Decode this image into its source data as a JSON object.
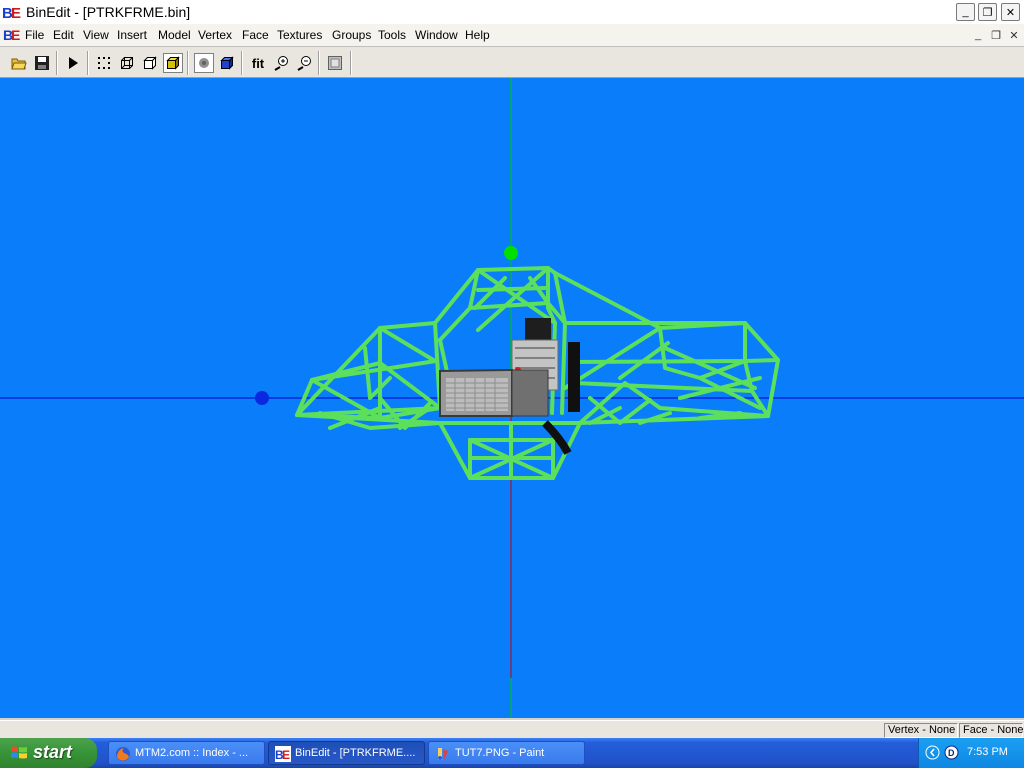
{
  "window": {
    "title": "BinEdit - [PTRKFRME.bin]",
    "minimize_label": "_",
    "maximize_label": "❐",
    "close_label": "✕"
  },
  "menu": {
    "items": [
      "File",
      "Edit",
      "View",
      "Insert",
      "Model",
      "Vertex",
      "Face",
      "Textures",
      "Groups",
      "Tools",
      "Window",
      "Help"
    ],
    "mdi_minimize": "_",
    "mdi_restore": "❐",
    "mdi_close": "✕"
  },
  "toolbar": {
    "fit_label": "fit",
    "icons": [
      "open-folder-icon",
      "save-icon",
      "play-icon",
      "vertices-icon",
      "wireframe-icon",
      "box-outline-icon",
      "solid-box-icon",
      "point-icon",
      "cube-icon",
      "zoom-in-icon",
      "zoom-out-icon",
      "grid-icon"
    ]
  },
  "viewport": {
    "background": "#0a7dfb",
    "wire_color": "#5ce05c",
    "axis_x_color": "#0000c8",
    "axis_y_color": "#00c800",
    "axis_z_color": "#c80000"
  },
  "status": {
    "vertex": "Vertex - None",
    "face": "Face - None"
  },
  "taskbar": {
    "start_label": "start",
    "tasks": [
      {
        "label": "MTM2.com :: Index - ...",
        "icon": "firefox-icon"
      },
      {
        "label": "BinEdit - [PTRKFRME....",
        "icon": "binedit-icon"
      },
      {
        "label": "TUT7.PNG - Paint",
        "icon": "paint-icon"
      }
    ],
    "clock": "7:53 PM"
  }
}
